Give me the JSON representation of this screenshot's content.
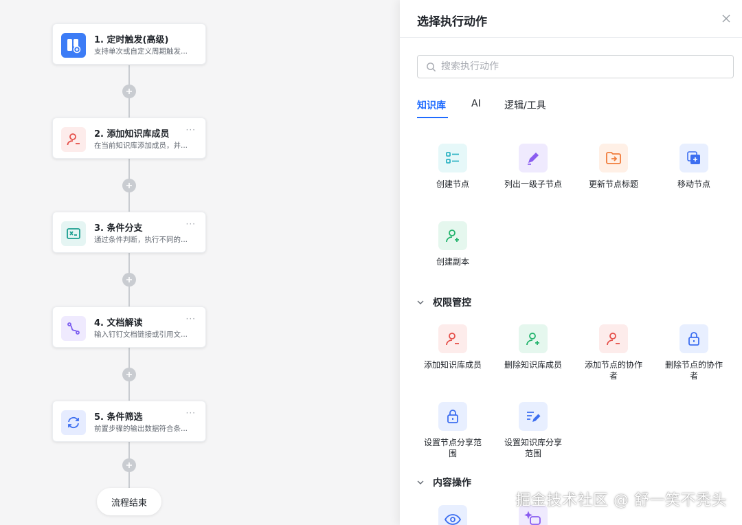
{
  "canvas": {
    "nodes": [
      {
        "title": "1. 定时触发(高级)",
        "desc": "支持单次或自定义周期触发..."
      },
      {
        "title": "2. 添加知识库成员",
        "desc": "在当前知识库添加成员，并...",
        "more": "···"
      },
      {
        "title": "3. 条件分支",
        "desc": "通过条件判断，执行不同的...",
        "more": "···"
      },
      {
        "title": "4. 文档解读",
        "desc": "输入钉钉文档链接或引用文...",
        "more": "···"
      },
      {
        "title": "5. 条件筛选",
        "desc": "前置步骤的输出数据符合条...",
        "more": "···"
      }
    ],
    "end_label": "流程结束"
  },
  "panel": {
    "title": "选择执行动作",
    "search_placeholder": "搜索执行动作",
    "tabs": [
      "知识库",
      "AI",
      "逻辑/工具"
    ],
    "knowledge_items": [
      {
        "label": "创建节点"
      },
      {
        "label": "列出一级子节点"
      },
      {
        "label": "更新节点标题"
      },
      {
        "label": "移动节点"
      },
      {
        "label": "创建副本"
      }
    ],
    "section_permission": "权限管控",
    "permission_items": [
      {
        "label": "添加知识库成员"
      },
      {
        "label": "删除知识库成员"
      },
      {
        "label": "添加节点的协作者"
      },
      {
        "label": "删除节点的协作者"
      },
      {
        "label": "设置节点分享范围"
      },
      {
        "label": "设置知识库分享范围"
      }
    ],
    "section_content": "内容操作"
  },
  "watermark": "掘金技术社区 @ 舒一笑不秃头",
  "colors": {
    "accent": "#1f6bff",
    "cyan_bg": "#e6f8f9",
    "purple_bg": "#efeafe",
    "orange_bg": "#fff0e6",
    "blue_bg": "#e8efff",
    "green_bg": "#e5f7ee",
    "red_bg": "#fdeceb"
  }
}
